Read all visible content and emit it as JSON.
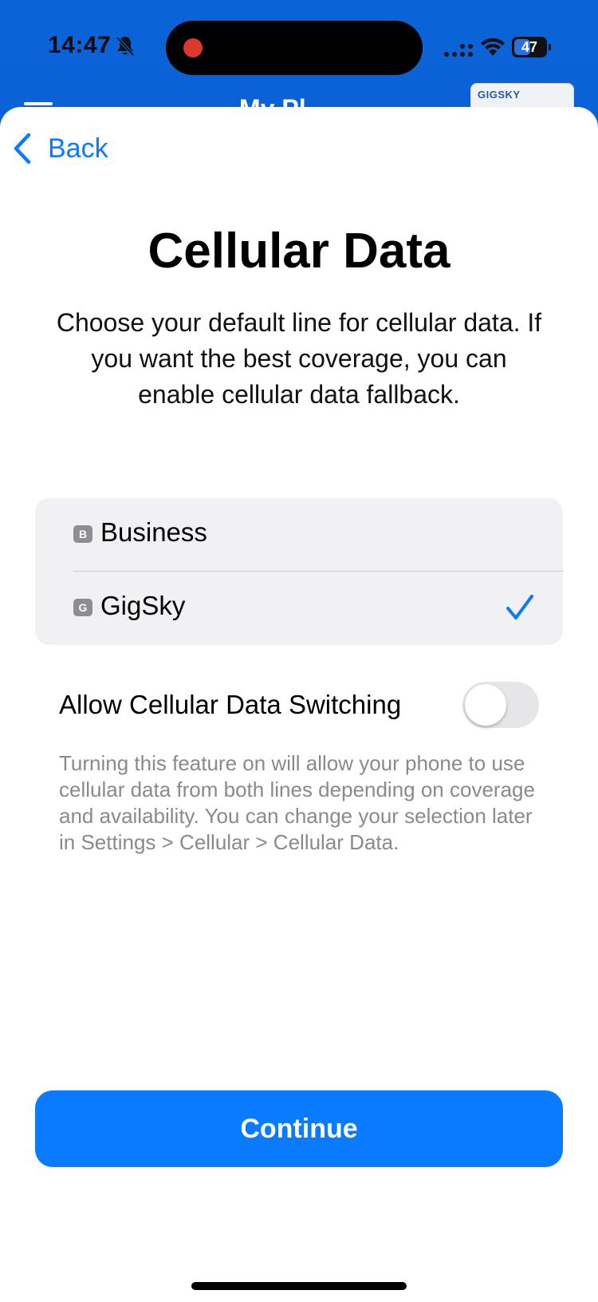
{
  "status_bar": {
    "time": "14:47",
    "battery": "47"
  },
  "behind": {
    "title": "My Pl",
    "card_logo": "GIGSKY"
  },
  "header": {
    "back_label": "Back"
  },
  "main": {
    "title": "Cellular Data",
    "subtitle": "Choose your default line for cellular data. If you want the best coverage, you can enable cellular data fallback."
  },
  "lines": [
    {
      "badge": "B",
      "label": "Business",
      "selected": false
    },
    {
      "badge": "G",
      "label": "GigSky",
      "selected": true
    }
  ],
  "switching": {
    "label": "Allow Cellular Data Switching",
    "enabled": false,
    "description": "Turning this feature on will allow your phone to use cellular data from both lines depending on coverage and availability. You can change your selection later in Settings > Cellular > Cellular Data."
  },
  "footer": {
    "continue_label": "Continue"
  },
  "colors": {
    "accent": "#0a7aff",
    "header_bg": "#0b63d8",
    "list_bg": "#f1f1f3",
    "secondary_text": "#8a8a8e"
  }
}
